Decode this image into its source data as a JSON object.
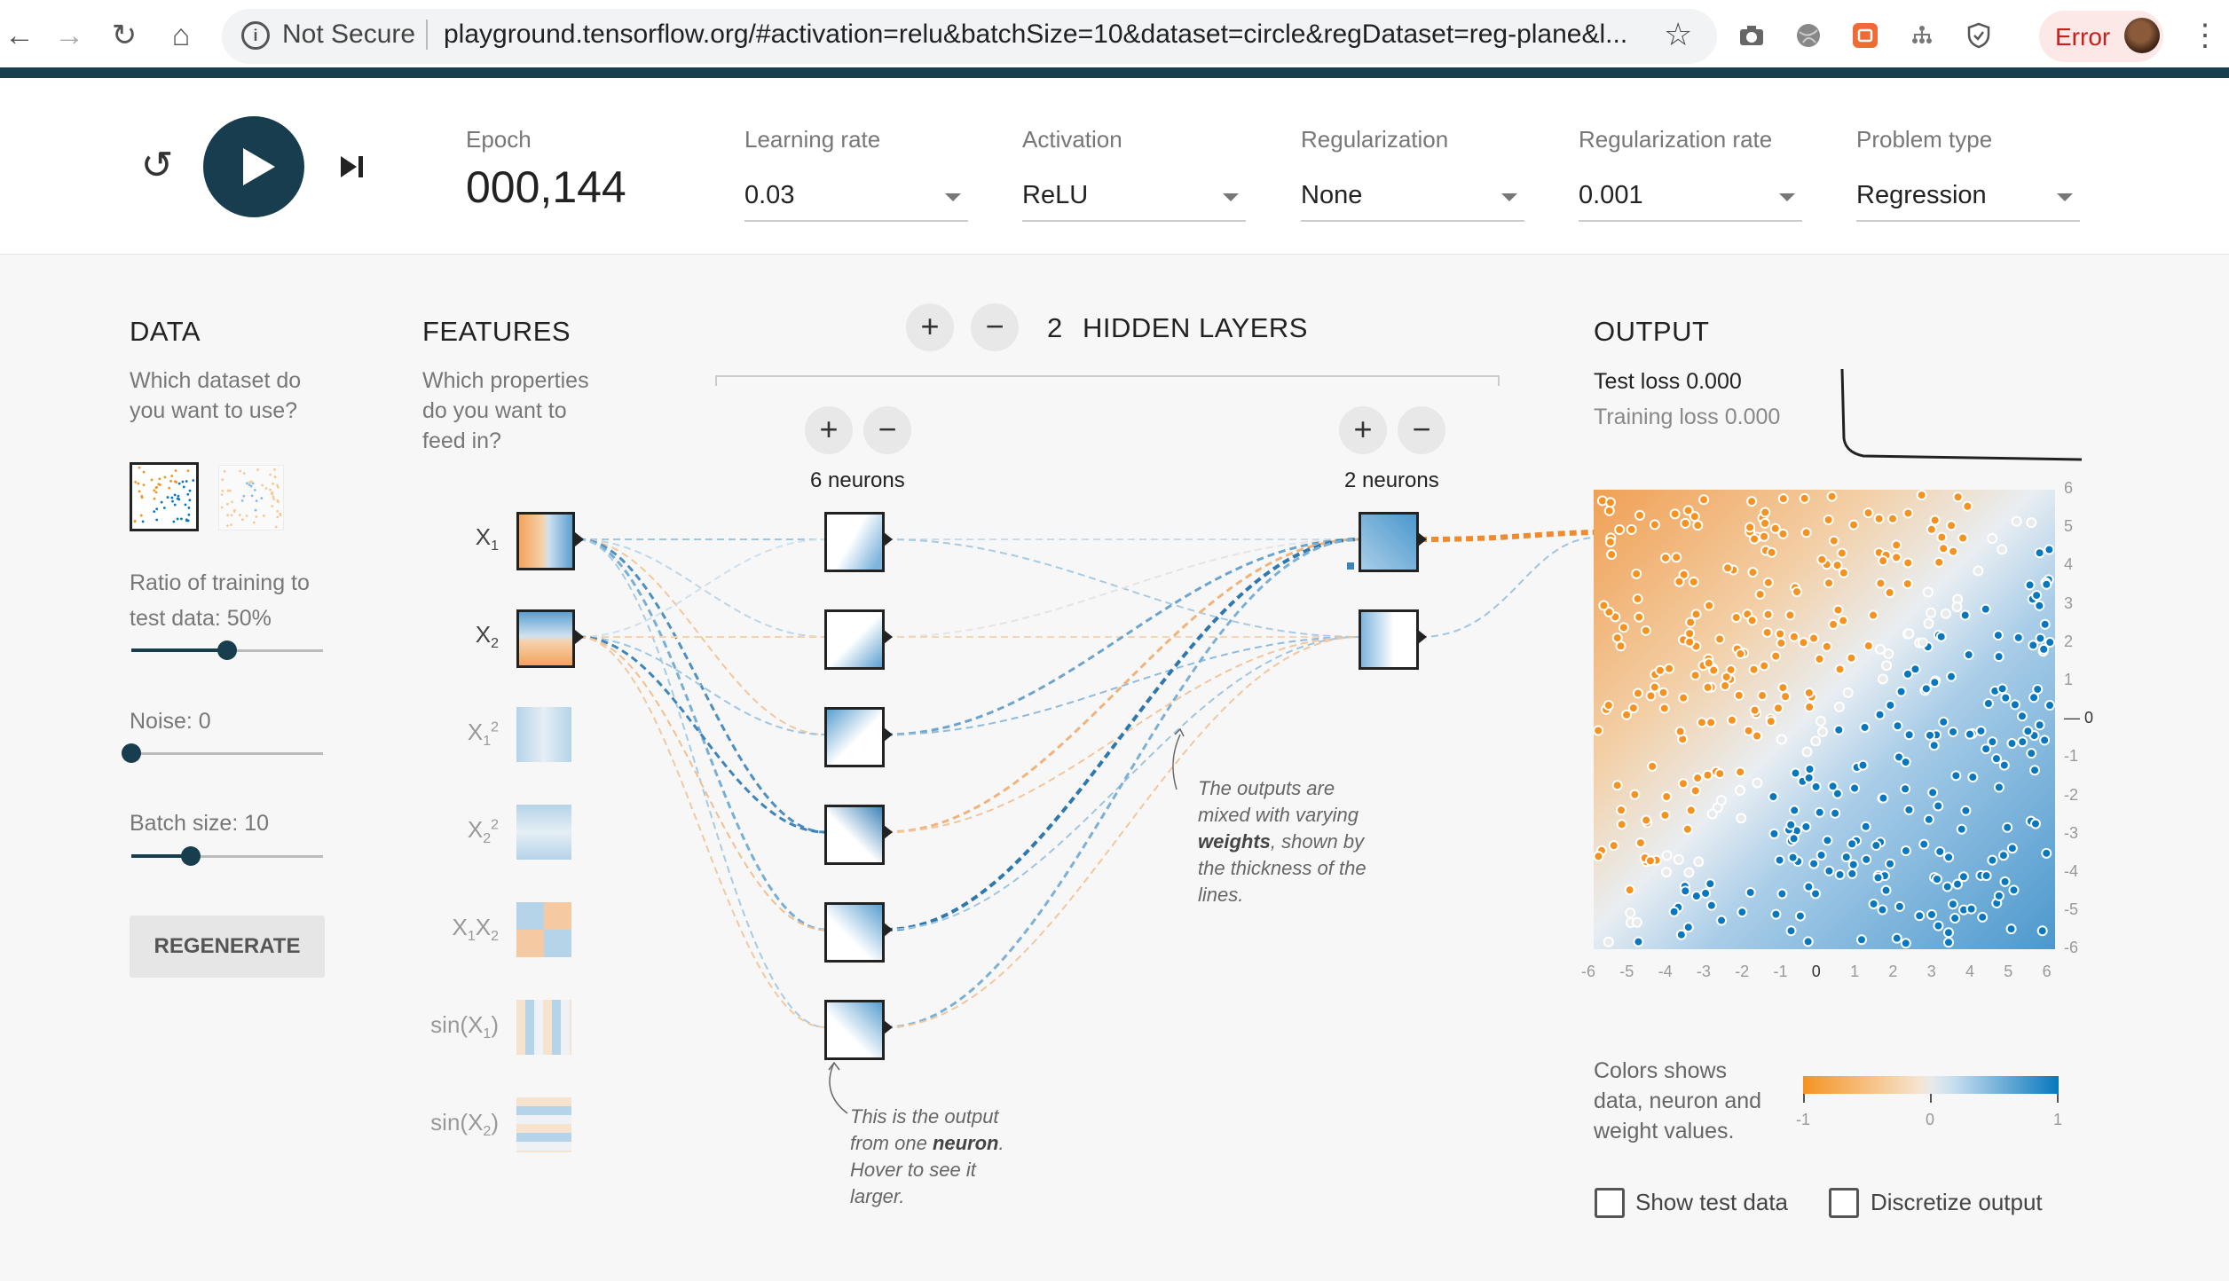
{
  "browser": {
    "not_secure": "Not Secure",
    "url": "playground.tensorflow.org/#activation=relu&batchSize=10&dataset=circle&regDataset=reg-plane&l...",
    "error_label": "Error"
  },
  "controls": {
    "epoch_label": "Epoch",
    "epoch_value": "000,144",
    "learning_rate_label": "Learning rate",
    "learning_rate_value": "0.03",
    "activation_label": "Activation",
    "activation_value": "ReLU",
    "regularization_label": "Regularization",
    "regularization_value": "None",
    "reg_rate_label": "Regularization rate",
    "reg_rate_value": "0.001",
    "problem_type_label": "Problem type",
    "problem_type_value": "Regression"
  },
  "data_panel": {
    "title": "DATA",
    "question_line1": "Which dataset do",
    "question_line2": "you want to use?",
    "ratio_line1": "Ratio of training to",
    "ratio_line2": "test data:  50%",
    "ratio_value": 0.5,
    "noise_label": "Noise:  0",
    "noise_value": 0,
    "batch_label": "Batch size:  10",
    "batch_value": 0.31,
    "regenerate": "REGENERATE"
  },
  "features_panel": {
    "title": "FEATURES",
    "question_line1": "Which properties",
    "question_line2": "do you want to",
    "question_line3": "feed in?",
    "features": [
      {
        "main": "X",
        "sub": "1",
        "sup": ""
      },
      {
        "main": "X",
        "sub": "2",
        "sup": ""
      },
      {
        "main": "X",
        "sub": "1",
        "sup": "2"
      },
      {
        "main": "X",
        "sub": "2",
        "sup": "2"
      },
      {
        "main": "X",
        "sub": "1",
        "main2": "X",
        "sub2": "2"
      },
      {
        "main": "sin(X",
        "sub": "1",
        "end": ")"
      },
      {
        "main": "sin(X",
        "sub": "2",
        "end": ")"
      }
    ]
  },
  "network": {
    "add_layer": "+",
    "remove_layer": "−",
    "layer_count": "2",
    "hidden_layers_label": "HIDDEN LAYERS",
    "layer1_neurons": "6 neurons",
    "layer2_neurons": "2 neurons",
    "note_weights_pre": "The outputs are mixed with varying ",
    "note_weights_bold": "weights",
    "note_weights_post": ", shown by the thickness of the lines.",
    "note_neuron_pre": "This is the output from one ",
    "note_neuron_bold": "neuron",
    "note_neuron_post": ". Hover to see it larger."
  },
  "output_panel": {
    "title": "OUTPUT",
    "test_loss": "Test loss 0.000",
    "training_loss": "Training loss 0.000",
    "x_ticks": [
      "-6",
      "-5",
      "-4",
      "-3",
      "-2",
      "-1",
      "0",
      "1",
      "2",
      "3",
      "4",
      "5",
      "6"
    ],
    "y_ticks": [
      "6",
      "5",
      "4",
      "3",
      "2",
      "1",
      "0",
      "-1",
      "-2",
      "-3",
      "-4",
      "-5",
      "-6"
    ],
    "legend_line1": "Colors shows",
    "legend_line2": "data, neuron and",
    "legend_line3": "weight values.",
    "colorbar_min": "-1",
    "colorbar_mid": "0",
    "colorbar_max": "1",
    "show_test_data": "Show test data",
    "discretize_output": "Discretize output",
    "orange": "#f59322",
    "blue": "#0877bd"
  }
}
